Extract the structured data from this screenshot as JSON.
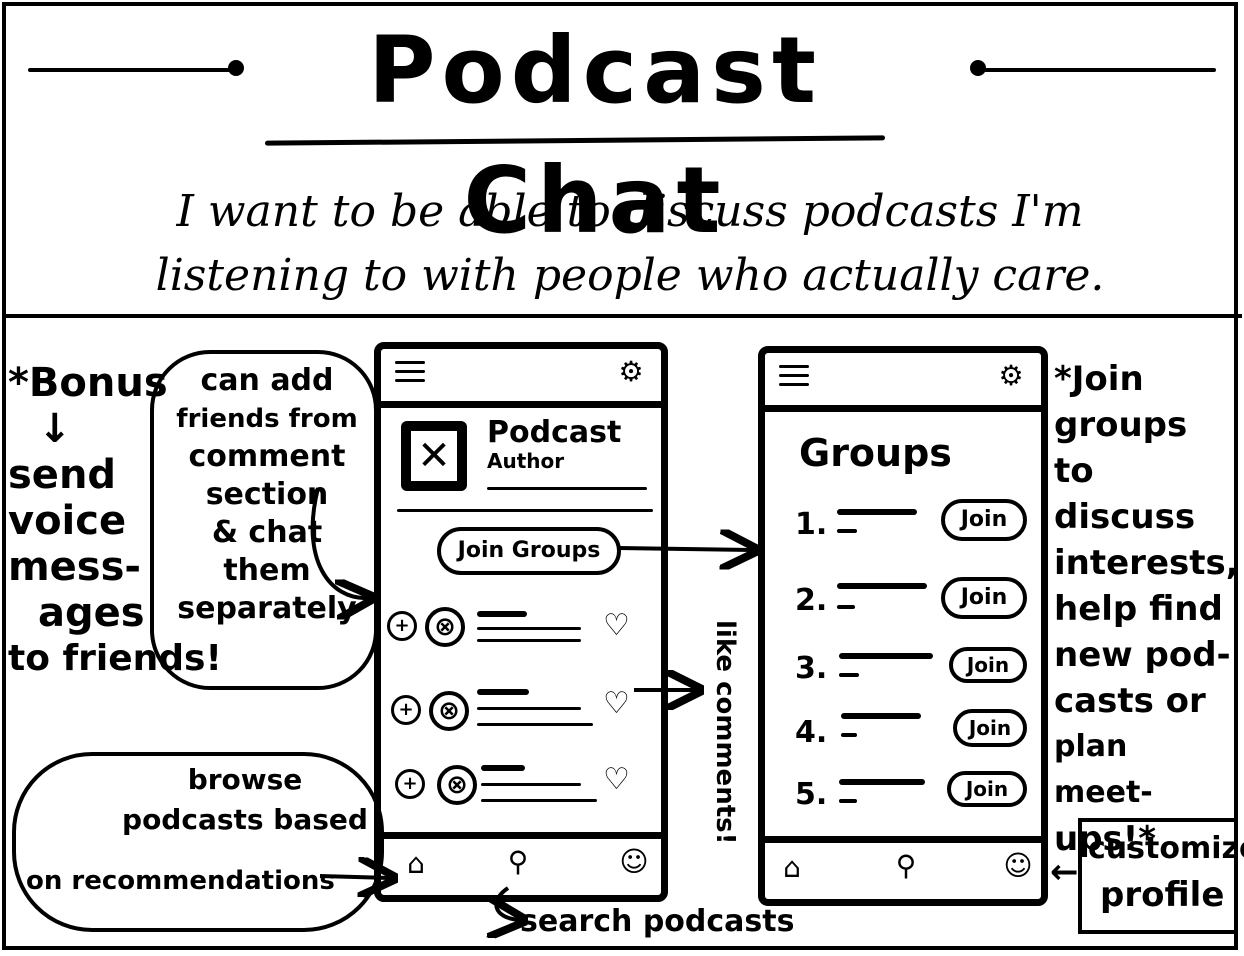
{
  "header": {
    "title": "Podcast Chat",
    "subtitle_line1": "I want to be able to discuss podcasts I'm",
    "subtitle_line2": "listening to with people who actually care."
  },
  "left_notes": {
    "bonus_title": "*Bonus",
    "bonus_arrow": "↓",
    "bonus_line1": "send",
    "bonus_line2": "voice",
    "bonus_line3": "mess-",
    "bonus_line4": "ages",
    "bonus_line5": "to friends!",
    "cloud_add_friends_line1": "can add",
    "cloud_add_friends_line2": "friends from",
    "cloud_add_friends_line3": "comment",
    "cloud_add_friends_line4": "section",
    "cloud_add_friends_line5": "& chat",
    "cloud_add_friends_line6": "them",
    "cloud_add_friends_line7": "separately",
    "cloud_browse_line1": "browse",
    "cloud_browse_line2": "podcasts based",
    "cloud_browse_line3": "on recommendations"
  },
  "phone_left": {
    "menu_icon": "hamburger-menu-icon",
    "settings_icon": "gear-icon",
    "podcast_title": "Podcast",
    "podcast_author": "Author",
    "join_groups_label": "Join Groups",
    "comments": [
      {
        "add_icon": "+",
        "avatar_icon": "⊗",
        "like_icon": "♡"
      },
      {
        "add_icon": "+",
        "avatar_icon": "⊗",
        "like_icon": "♡"
      },
      {
        "add_icon": "+",
        "avatar_icon": "⊗",
        "like_icon": "♡"
      }
    ],
    "nav_home_icon": "⌂",
    "nav_search_icon": "⚲",
    "nav_profile_icon": "☺"
  },
  "middle_notes": {
    "like_comments": "like comments!",
    "search_podcasts": "search podcasts"
  },
  "phone_right": {
    "menu_icon": "hamburger-menu-icon",
    "settings_icon": "gear-icon",
    "groups_title": "Groups",
    "groups": [
      {
        "num": "1.",
        "join": "Join"
      },
      {
        "num": "2.",
        "join": "Join"
      },
      {
        "num": "3.",
        "join": "Join"
      },
      {
        "num": "4.",
        "join": "Join"
      },
      {
        "num": "5.",
        "join": "Join"
      }
    ],
    "nav_home_icon": "⌂",
    "nav_search_icon": "⚲",
    "nav_profile_icon": "☺"
  },
  "right_notes": {
    "join_line1": "*Join",
    "join_line2": "groups to",
    "join_line3": "discuss",
    "join_line4": "interests,",
    "join_line5": "help find",
    "join_line6": "new pod-",
    "join_line7": "casts or",
    "join_line8": "plan meet-",
    "join_line9": "ups!*",
    "customize_line1": "customize",
    "customize_line2": "profile",
    "customize_arrow": "←"
  }
}
